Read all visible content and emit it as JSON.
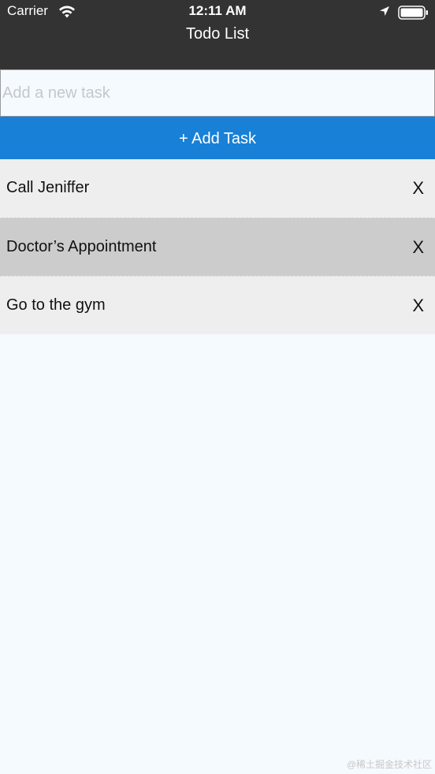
{
  "status_bar": {
    "carrier": "Carrier",
    "time": "12:11 AM",
    "icons": [
      "wifi-icon",
      "location-icon",
      "battery-icon"
    ]
  },
  "header": {
    "title": "Todo List",
    "background": "#333333"
  },
  "input": {
    "placeholder": "Add a new task",
    "value": ""
  },
  "add_button": {
    "label": "+ Add Task",
    "color": "#1880d6"
  },
  "tasks": [
    {
      "label": "Call Jeniffer",
      "delete_label": "X"
    },
    {
      "label": "Doctor’s Appointment",
      "delete_label": "X"
    },
    {
      "label": "Go to the gym",
      "delete_label": "X"
    }
  ],
  "watermark": "@稀土掘金技术社区"
}
